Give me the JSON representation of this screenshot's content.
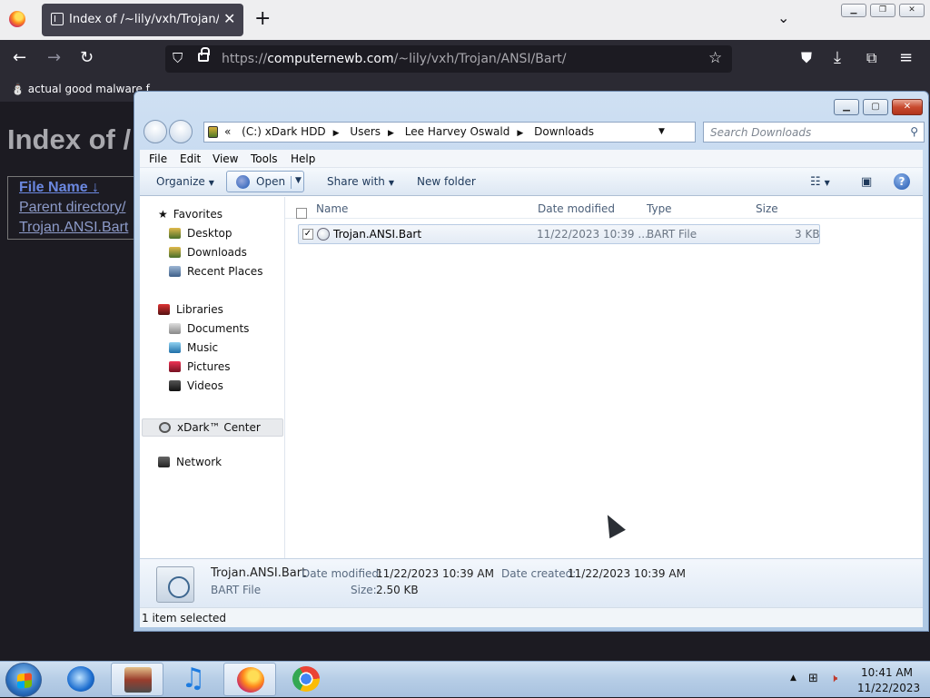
{
  "browser": {
    "tab_title": "Index of /~lily/vxh/Trojan/ANSI/Bart/",
    "url_protocol": "https://",
    "url_domain": "computernewb.com",
    "url_path": "/~lily/vxh/Trojan/ANSI/Bart/",
    "bookmark": "actual good malware f"
  },
  "page": {
    "heading": "Index of /",
    "header": {
      "col": "File Name",
      "sort": "↓"
    },
    "rows": [
      "Parent directory/",
      "Trojan.ANSI.Bart"
    ]
  },
  "explorer": {
    "breadcrumbs": [
      "«",
      "(C:) xDark HDD",
      "Users",
      "Lee Harvey Oswald",
      "Downloads"
    ],
    "search_placeholder": "Search Downloads",
    "menu": [
      "File",
      "Edit",
      "View",
      "Tools",
      "Help"
    ],
    "commands": {
      "organize": "Organize",
      "open": "Open",
      "share": "Share with",
      "new_folder": "New folder"
    },
    "nav": {
      "favorites": "Favorites",
      "desktop": "Desktop",
      "downloads": "Downloads",
      "recent": "Recent Places",
      "libraries": "Libraries",
      "documents": "Documents",
      "music": "Music",
      "pictures": "Pictures",
      "videos": "Videos",
      "xdark": "xDark™ Center",
      "network": "Network"
    },
    "columns": {
      "name": "Name",
      "date": "Date modified",
      "type": "Type",
      "size": "Size"
    },
    "file": {
      "name": "Trojan.ANSI.Bart",
      "date": "11/22/2023 10:39 ...",
      "type": "BART File",
      "size": "3 KB"
    },
    "details": {
      "name": "Trojan.ANSI.Bart",
      "type": "BART File",
      "modified_label": "Date modified:",
      "modified": "11/22/2023 10:39 AM",
      "created_label": "Date created:",
      "created": "11/22/2023 10:39 AM",
      "size_label": "Size:",
      "size": "2.50 KB"
    },
    "status": "1 item selected"
  },
  "taskbar": {
    "time": "10:41 AM",
    "date": "11/22/2023"
  }
}
